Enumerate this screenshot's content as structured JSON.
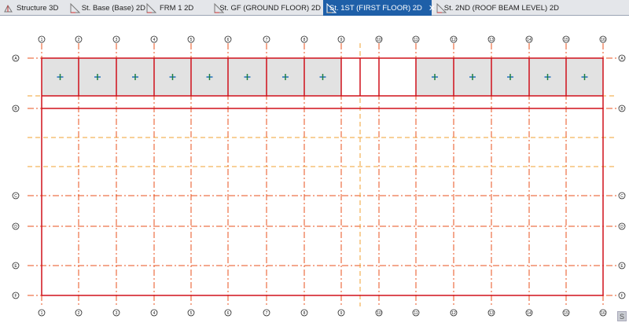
{
  "tabs": [
    {
      "label": "Structure 3D",
      "icon": "3d-structure-icon",
      "active": false
    },
    {
      "label": "St. Base (Base) 2D",
      "icon": "plan-view-icon",
      "active": false
    },
    {
      "label": "FRM 1 2D",
      "icon": "frame-view-icon",
      "active": false
    },
    {
      "label": "St. GF (GROUND FLOOR) 2D",
      "icon": "plan-view-icon",
      "active": false
    },
    {
      "label": "St. 1ST (FIRST FLOOR) 2D",
      "icon": "plan-view-icon",
      "active": true
    },
    {
      "label": "St. 2ND (ROOF BEAM LEVEL) 2D",
      "icon": "plan-view-icon",
      "active": false
    }
  ],
  "close_symbol": "✕",
  "grid": {
    "x_labels": [
      "1",
      "2",
      "3",
      "4",
      "5",
      "6",
      "7",
      "8",
      "9",
      "10",
      "11",
      "12",
      "13",
      "14",
      "15",
      "16"
    ],
    "y_labels": [
      "A",
      "B",
      "C",
      "D",
      "E",
      "F"
    ],
    "colors": {
      "grid_line": "#e8501e",
      "aux_line": "#f0a030",
      "beam": "#d0101a",
      "panel": "#e2e2e2",
      "column": "#2070c0"
    }
  },
  "corner_button": "S"
}
